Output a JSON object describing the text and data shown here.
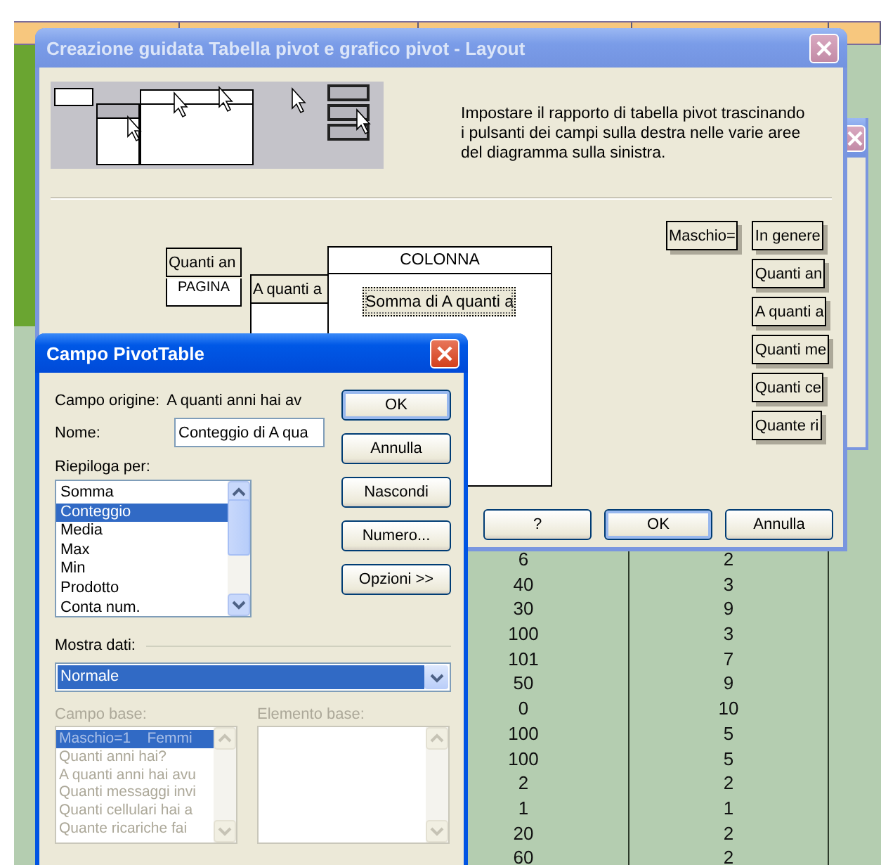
{
  "spreadsheet": {
    "rows": [
      {
        "column_1": "6",
        "column_2": "2"
      },
      {
        "column_1": "40",
        "column_2": "3"
      },
      {
        "column_1": "30",
        "column_2": "9"
      },
      {
        "column_1": "100",
        "column_2": "3"
      },
      {
        "column_1": "101",
        "column_2": "7"
      },
      {
        "column_1": "50",
        "column_2": "9"
      },
      {
        "column_1": "0",
        "column_2": "10"
      },
      {
        "column_1": "100",
        "column_2": "5"
      },
      {
        "column_1": "100",
        "column_2": "5"
      },
      {
        "column_1": "2",
        "column_2": "2"
      },
      {
        "column_1": "1",
        "column_2": "1"
      },
      {
        "column_1": "20",
        "column_2": "2"
      },
      {
        "column_1": "60",
        "column_2": "2"
      }
    ]
  },
  "wizard": {
    "title": "Creazione guidata Tabella pivot e grafico pivot - Layout",
    "active": false,
    "instructions": "Impostare il rapporto di tabella pivot trascinando i pulsanti dei campi sulla destra nelle varie aree del diagramma sulla sinistra.",
    "page_area": {
      "label": "PAGINA",
      "fields": [
        "Quanti an"
      ]
    },
    "row_area": {
      "fields": [
        "A quanti a"
      ]
    },
    "column_area": {
      "label": "COLONNA"
    },
    "data_area": {
      "fields": [
        "Somma di A quanti a"
      ]
    },
    "field_buttons": [
      "Maschio=",
      "In genere",
      "Quanti an",
      "A quanti a",
      "Quanti me",
      "Quanti ce",
      "Quante ri"
    ],
    "buttons": [
      {
        "label": "?",
        "default": false
      },
      {
        "label": "OK",
        "default": true
      },
      {
        "label": "Annulla",
        "default": false
      }
    ]
  },
  "field_dialog": {
    "title": "Campo PivotTable",
    "active": true,
    "source_label": "Campo origine:",
    "source_value": "A quanti anni hai av",
    "name_label": "Nome:",
    "name_value": "Conteggio di A qua",
    "summarize_label": "Riepiloga per:",
    "summarize_items": [
      {
        "label": "Somma",
        "selected": false
      },
      {
        "label": "Conteggio",
        "selected": true
      },
      {
        "label": "Media",
        "selected": false
      },
      {
        "label": "Max",
        "selected": false
      },
      {
        "label": "Min",
        "selected": false
      },
      {
        "label": "Prodotto",
        "selected": false
      },
      {
        "label": "Conta num.",
        "selected": false
      }
    ],
    "buttons": [
      {
        "label": "OK",
        "default": true
      },
      {
        "label": "Annulla",
        "default": false
      },
      {
        "label": "Nascondi",
        "default": false
      },
      {
        "label": "Numero...",
        "default": false
      },
      {
        "label": "Opzioni >>",
        "default": false
      }
    ],
    "show_data_label": "Mostra dati:",
    "show_data_value": "Normale",
    "base_field": {
      "label": "Campo base:",
      "disabled": true,
      "items": [
        {
          "label": "Maschio=1    Femmi",
          "selected": true
        },
        {
          "label": "Quanti anni hai?",
          "selected": false
        },
        {
          "label": "A quanti anni hai avu",
          "selected": false
        },
        {
          "label": "Quanti messaggi invi",
          "selected": false
        },
        {
          "label": "Quanti cellulari hai a",
          "selected": false
        },
        {
          "label": "Quante ricariche fai",
          "selected": false
        }
      ]
    },
    "base_item": {
      "label": "Elemento base:",
      "disabled": true
    }
  }
}
